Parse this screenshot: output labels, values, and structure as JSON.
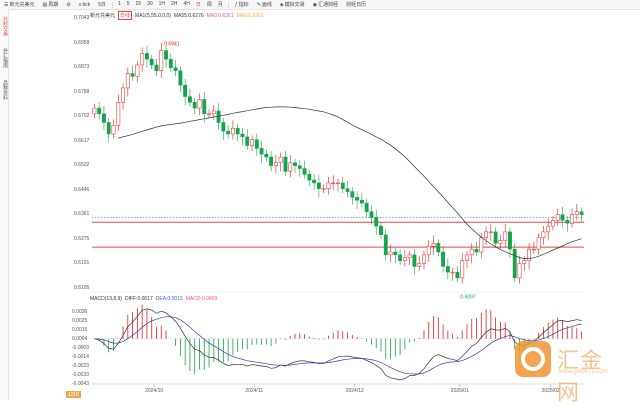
{
  "toolbar": {
    "symbol": "新元兑美元",
    "items": [
      {
        "icon": "chart-type-icon",
        "label": "周期"
      },
      {
        "icon": "gear-icon",
        "label": ""
      },
      {
        "icon": "lines-icon",
        "label": "tick"
      },
      {
        "icon": "",
        "label": "5日"
      }
    ],
    "periods": [
      "1",
      "5",
      "15",
      "30",
      "1H",
      "2H",
      "4H",
      "日",
      "周",
      "月"
    ],
    "right_items": [
      "指标",
      "画线",
      "模拟交易",
      "汇通财经",
      "财经日历"
    ]
  },
  "sidebar": {
    "tabs": [
      "分时交易",
      "外汇指南",
      "品种资料"
    ]
  },
  "main_legend": {
    "title": "新元兑美元",
    "period_badge": "日线",
    "items": [
      {
        "text": "MA1(5,55,0,0,0)",
        "color": "#333333"
      },
      {
        "text": "MA55:0.6276",
        "color": "#333333"
      },
      {
        "text": "MA0:0.6361",
        "color": "#e05c9f"
      },
      {
        "text": "MA0:0.6361",
        "color": "#f0a84b"
      }
    ]
  },
  "macd_legend": {
    "items": [
      {
        "text": "MACD(13,8,9)",
        "color": "#333333"
      },
      {
        "text": "DIFF:0.0017",
        "color": "#333333"
      },
      {
        "text": "DEA:0.0013",
        "color": "#3b5bdb"
      },
      {
        "text": "MACD:0.0009",
        "color": "#e05c9f"
      }
    ]
  },
  "bottom": {
    "badge": "1日K"
  },
  "watermark": {
    "text": "汇金网",
    "url": "www.gold678.com"
  },
  "colors": {
    "up": "#e02020",
    "down": "#16a34a",
    "ma": "#333333",
    "hline": "#e04848",
    "current": "#5b9bd5",
    "dea": "#3b3bb0"
  },
  "chart_data": [
    {
      "type": "candlestick",
      "title": "新元兑美元",
      "y_ticks": [
        "0.7043",
        "0.6958",
        "0.6873",
        "0.6788",
        "0.6702",
        "0.6617",
        "0.6532",
        "0.6446",
        "0.6361",
        "0.6275",
        "0.6191",
        "0.6105"
      ],
      "x_ticks": [
        "2024/10",
        "2024/11",
        "2024/12",
        "2025/01",
        "2025/02"
      ],
      "ylim": [
        0.6105,
        0.7043
      ],
      "annotations": [
        {
          "label": "0.6941",
          "value": 0.6941
        },
        {
          "label": "0.6097",
          "value": 0.6097
        }
      ],
      "horizontal_lines": [
        0.6361,
        0.6275
      ],
      "current_price": 0.635,
      "close": [
        0.673,
        0.671,
        0.668,
        0.664,
        0.667,
        0.675,
        0.68,
        0.685,
        0.684,
        0.688,
        0.692,
        0.69,
        0.688,
        0.686,
        0.693,
        0.69,
        0.687,
        0.686,
        0.681,
        0.677,
        0.675,
        0.673,
        0.676,
        0.671,
        0.671,
        0.672,
        0.668,
        0.665,
        0.664,
        0.666,
        0.664,
        0.663,
        0.66,
        0.662,
        0.659,
        0.657,
        0.656,
        0.653,
        0.654,
        0.656,
        0.651,
        0.654,
        0.653,
        0.652,
        0.65,
        0.648,
        0.647,
        0.645,
        0.645,
        0.647,
        0.647,
        0.647,
        0.645,
        0.644,
        0.642,
        0.641,
        0.64,
        0.637,
        0.635,
        0.632,
        0.629,
        0.622,
        0.623,
        0.622,
        0.62,
        0.621,
        0.622,
        0.618,
        0.619,
        0.622,
        0.625,
        0.626,
        0.623,
        0.618,
        0.616,
        0.616,
        0.614,
        0.62,
        0.622,
        0.624,
        0.623,
        0.628,
        0.63,
        0.63,
        0.626,
        0.627,
        0.63,
        0.624,
        0.614,
        0.619,
        0.62,
        0.624,
        0.624,
        0.628,
        0.63,
        0.632,
        0.634,
        0.636,
        0.634,
        0.633,
        0.636,
        0.637,
        0.636
      ],
      "ma55": [
        0.6626,
        0.663,
        0.6634,
        0.6639,
        0.6644,
        0.6649,
        0.6654,
        0.6659,
        0.6664,
        0.6668,
        0.6671,
        0.6673,
        0.6675,
        0.6678,
        0.6681,
        0.6684,
        0.6687,
        0.669,
        0.6693,
        0.6696,
        0.6699,
        0.6702,
        0.6705,
        0.6708,
        0.6712,
        0.6715,
        0.6718,
        0.6721,
        0.6724,
        0.6727,
        0.673,
        0.6732,
        0.6733,
        0.6734,
        0.6734,
        0.6734,
        0.6733,
        0.6732,
        0.673,
        0.6728,
        0.6726,
        0.6723,
        0.672,
        0.6717,
        0.6712,
        0.6706,
        0.6699,
        0.669,
        0.6681,
        0.6671,
        0.6663,
        0.6655,
        0.6647,
        0.6639,
        0.663,
        0.6622,
        0.6611,
        0.6601,
        0.6589,
        0.6575,
        0.6561,
        0.6544,
        0.6527,
        0.651,
        0.6493,
        0.6475,
        0.6457,
        0.6439,
        0.6421,
        0.6402,
        0.6384,
        0.6366,
        0.6346,
        0.6327,
        0.6311,
        0.6296,
        0.6281,
        0.627,
        0.6258,
        0.6248,
        0.6238,
        0.6231,
        0.6224,
        0.6217,
        0.6211,
        0.6207,
        0.6207,
        0.621,
        0.6215,
        0.6222,
        0.6229,
        0.6237,
        0.6244,
        0.6251,
        0.6259,
        0.6266,
        0.6271,
        0.6276
      ]
    },
    {
      "type": "macd",
      "title": "MACD(13,8,9)",
      "y_ticks": [
        "0.0036",
        "0.0025",
        "0.0015",
        "0.0004",
        "-0.0003",
        "-0.0014",
        "-0.0023",
        "-0.0033",
        "-0.0043"
      ],
      "ylim": [
        -0.0048,
        0.0041
      ]
    }
  ]
}
